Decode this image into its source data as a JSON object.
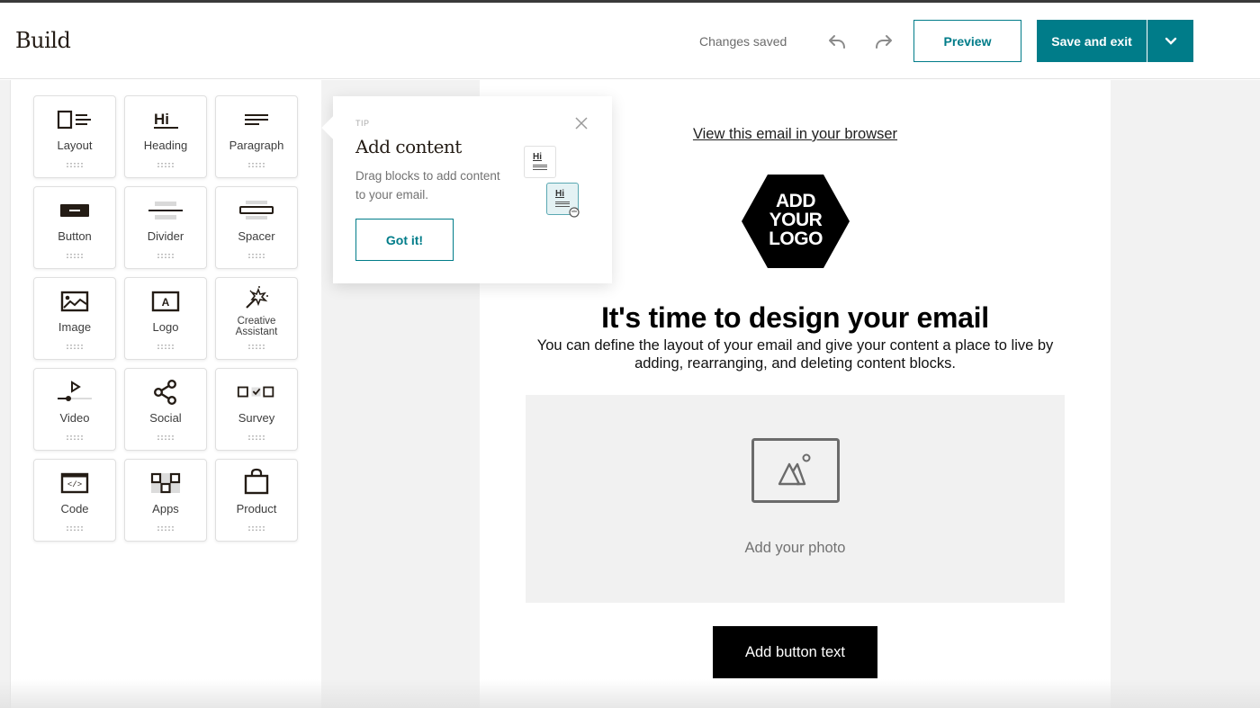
{
  "header": {
    "title": "Build",
    "status": "Changes saved",
    "undo_icon": "undo-arrow-icon",
    "redo_icon": "redo-arrow-icon",
    "preview_label": "Preview",
    "save_label": "Save and exit",
    "dropdown_icon": "chevron-down-icon"
  },
  "colors": {
    "accent": "#007c89",
    "text_dark": "#241c15",
    "panel_gray": "#f2f2f2",
    "photo_placeholder": "#f1f1f1",
    "cta_bg": "#000000"
  },
  "blocks": [
    {
      "label": "Layout",
      "icon": "layout-icon"
    },
    {
      "label": "Heading",
      "icon": "heading-icon"
    },
    {
      "label": "Paragraph",
      "icon": "paragraph-icon"
    },
    {
      "label": "Button",
      "icon": "button-icon"
    },
    {
      "label": "Divider",
      "icon": "divider-icon"
    },
    {
      "label": "Spacer",
      "icon": "spacer-icon"
    },
    {
      "label": "Image",
      "icon": "image-icon"
    },
    {
      "label": "Logo",
      "icon": "logo-icon"
    },
    {
      "label_line1": "Creative",
      "label_line2": "Assistant",
      "icon": "magic-wand-icon"
    },
    {
      "label": "Video",
      "icon": "video-icon"
    },
    {
      "label": "Social",
      "icon": "share-icon"
    },
    {
      "label": "Survey",
      "icon": "survey-icon"
    },
    {
      "label": "Code",
      "icon": "code-icon"
    },
    {
      "label": "Apps",
      "icon": "apps-icon"
    },
    {
      "label": "Product",
      "icon": "shopping-bag-icon"
    }
  ],
  "tip": {
    "label": "TIP",
    "title": "Add content",
    "body": "Drag blocks to add content to your email.",
    "button": "Got it!",
    "mini_text": "Hi"
  },
  "email": {
    "view_link": "View this email in your browser",
    "logo_line1": "ADD",
    "logo_line2": "YOUR",
    "logo_line3": "LOGO",
    "headline": "It's time to design your email",
    "subtext": "You can define the layout of your email and give your content a place to live by adding, rearranging, and deleting content blocks.",
    "photo_label": "Add your photo",
    "button_text": "Add button text"
  }
}
